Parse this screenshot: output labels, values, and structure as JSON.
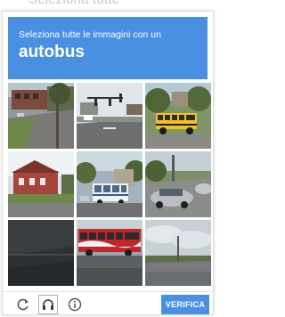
{
  "background_text": "Seleziona tutte",
  "header": {
    "instruction": "Seleziona tutte le immagini con un",
    "target_word": "autobus",
    "color": "#4a90e2"
  },
  "grid": {
    "rows": 3,
    "columns": 3,
    "tiles": [
      {
        "row": 1,
        "col": 1,
        "scene": "brick-building-intersection"
      },
      {
        "row": 1,
        "col": 2,
        "scene": "traffic-light-street"
      },
      {
        "row": 1,
        "col": 3,
        "scene": "yellow-school-bus"
      },
      {
        "row": 2,
        "col": 1,
        "scene": "red-brick-building"
      },
      {
        "row": 2,
        "col": 2,
        "scene": "white-bus-street"
      },
      {
        "row": 2,
        "col": 3,
        "scene": "silver-car-parking"
      },
      {
        "row": 3,
        "col": 1,
        "scene": "dark-asphalt"
      },
      {
        "row": 3,
        "col": 2,
        "scene": "red-white-bus"
      },
      {
        "row": 3,
        "col": 3,
        "scene": "cloudy-sky-road"
      }
    ]
  },
  "footer": {
    "reload_icon": "reload-icon",
    "audio_icon": "headphones-icon",
    "info_icon": "info-icon",
    "verify_label": "VERIFICA",
    "verify_color": "#4a90e2"
  }
}
